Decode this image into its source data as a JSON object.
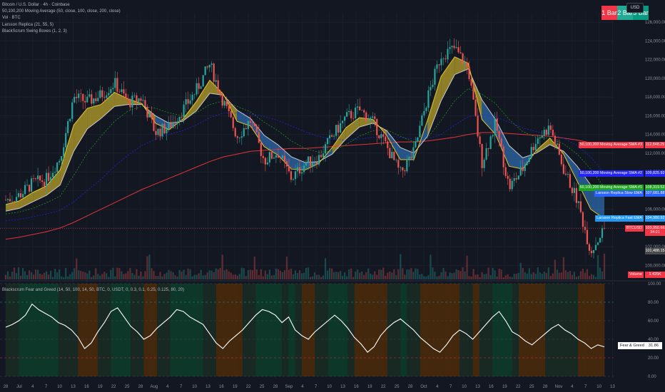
{
  "header": {
    "symbol_line": "Bitcoin / U.S. Dollar · 4h · Coinbase",
    "indicators": [
      "50,100,200 Moving Average (50, close, 100, close, 200, close)",
      "Vol · BTC",
      "Larsson Replica (21, 55, 5)",
      "BlackScrum Swing Boxes (1, 2, 3)"
    ],
    "currency": "USD",
    "bar_buttons": [
      {
        "label": "1 Bar",
        "color": "#f23645"
      },
      {
        "label": "2 Bar",
        "color": "#22ab94"
      },
      {
        "label": "3 Bar",
        "color": "#22ab94"
      }
    ]
  },
  "price_tags": [
    {
      "label": "50,100,200 Moving Average SMA #3",
      "value": "112,848.25",
      "color": "#f23645",
      "price": 112848
    },
    {
      "label": "50,100,200 Moving Average SMA #2",
      "value": "109,825.92",
      "color": "#2424f5",
      "price": 109826
    },
    {
      "label": "50,100,200 Moving Average SMA #1",
      "value": "108,319.52",
      "color": "#1ea31e",
      "price": 108320
    },
    {
      "label": "Larsson Replica Slow EMA",
      "value": "107,681.88",
      "color": "#2962ff",
      "price": 107682
    },
    {
      "label": "Larsson Replica Fast EMA",
      "value": "104,980.92",
      "color": "#2196f3",
      "price": 104981
    },
    {
      "label": "BTCUSD",
      "value": "103,950.66",
      "color": "#f23645",
      "price": 103951
    },
    {
      "label": "",
      "value": "34:21",
      "color": "#f23645",
      "price": 103500
    },
    {
      "label": "",
      "value": "101,488.15",
      "color": "#4a4a4a",
      "price": 101488
    }
  ],
  "volume_tag": {
    "label": "Volume",
    "value": "1.425K",
    "color": "#f23645"
  },
  "oscillator": {
    "title": "Blackscrum Fear and Greed (14, 50, 100, 14, 50, BTC, 0, USDT, 0, 0.3, 0.1, 0.25, 0.125, 80, 20)",
    "label": "Fear & Greed Score",
    "value": "31.86",
    "ticks": [
      "100.00",
      "80.00",
      "60.00",
      "40.00",
      "20.00",
      "0.00"
    ]
  },
  "chart_data": {
    "type": "line",
    "title": "Bitcoin / U.S. Dollar · 4h · Coinbase",
    "y_axis_ticks": [
      "126,000.00",
      "124,000.00",
      "122,000.00",
      "120,000.00",
      "118,000.00",
      "116,000.00",
      "114,000.00",
      "112,000.00",
      "110,000.00",
      "108,000.00",
      "106,000.00",
      "104,000.00",
      "102,000.00",
      "100,000.00"
    ],
    "ylim": [
      98500,
      127000
    ],
    "x_axis_ticks": [
      "28",
      "Jul",
      "4",
      "7",
      "10",
      "13",
      "16",
      "19",
      "22",
      "25",
      "28",
      "Aug",
      "4",
      "7",
      "10",
      "13",
      "16",
      "19",
      "22",
      "25",
      "28",
      "Sep",
      "4",
      "7",
      "10",
      "13",
      "16",
      "19",
      "22",
      "25",
      "28",
      "Oct",
      "4",
      "7",
      "10",
      "13",
      "16",
      "19",
      "22",
      "25",
      "28",
      "Nov",
      "4",
      "7",
      "10",
      "13"
    ],
    "x_dates": [
      "2025-06-27",
      "2025-07-01",
      "2025-07-04",
      "2025-07-07",
      "2025-07-10",
      "2025-07-13",
      "2025-07-16",
      "2025-07-19",
      "2025-07-22",
      "2025-07-25",
      "2025-07-28",
      "2025-08-01",
      "2025-08-04",
      "2025-08-07",
      "2025-08-10",
      "2025-08-13",
      "2025-08-16",
      "2025-08-19",
      "2025-08-22",
      "2025-08-25",
      "2025-08-28",
      "2025-09-01",
      "2025-09-04",
      "2025-09-07",
      "2025-09-10",
      "2025-09-13",
      "2025-09-16",
      "2025-09-19",
      "2025-09-22",
      "2025-09-25",
      "2025-09-28",
      "2025-10-01",
      "2025-10-04",
      "2025-10-07",
      "2025-10-10",
      "2025-10-13",
      "2025-10-16",
      "2025-10-19",
      "2025-10-22",
      "2025-10-25",
      "2025-10-28",
      "2025-11-01",
      "2025-11-04"
    ],
    "series": [
      {
        "name": "BTCUSD",
        "color": "#d1d4dc",
        "values": [
          107000,
          107500,
          108800,
          109200,
          111500,
          118000,
          117500,
          118200,
          119500,
          117400,
          117900,
          114200,
          114800,
          116600,
          118700,
          121500,
          117500,
          113800,
          115500,
          111200,
          112100,
          109300,
          110900,
          111500,
          113800,
          115800,
          116600,
          115300,
          112700,
          109800,
          112100,
          117900,
          122500,
          123200,
          121000,
          111000,
          115200,
          108300,
          110300,
          113500,
          114800,
          110300,
          107000,
          101488,
          103951
        ]
      },
      {
        "name": "Larsson Replica Fast EMA",
        "color": "#e8c62b",
        "values": [
          106500,
          106900,
          107800,
          108500,
          110200,
          115000,
          116800,
          117200,
          118500,
          117800,
          117300,
          115200,
          114500,
          115600,
          117500,
          119800,
          118300,
          115400,
          114900,
          112700,
          111800,
          110300,
          110200,
          110900,
          112600,
          114700,
          115800,
          115600,
          113900,
          111300,
          111300,
          115500,
          120200,
          122300,
          121600,
          115600,
          114000,
          110600,
          110300,
          112300,
          113600,
          111900,
          109000,
          106000,
          104981
        ]
      },
      {
        "name": "Larsson Replica Slow EMA",
        "color": "#c9c9c9",
        "values": [
          105800,
          106100,
          106800,
          107500,
          108600,
          112200,
          114600,
          115700,
          117000,
          117200,
          117200,
          116000,
          115200,
          115400,
          116500,
          118400,
          118200,
          116600,
          115700,
          113900,
          112900,
          111600,
          111000,
          111100,
          111900,
          113500,
          114800,
          115200,
          114400,
          112600,
          112000,
          113800,
          117600,
          120400,
          121000,
          117700,
          115600,
          112800,
          111500,
          112000,
          112900,
          112200,
          110600,
          108600,
          107682
        ]
      },
      {
        "name": "50,100,200 Moving Average SMA #1",
        "color": "#1ea31e",
        "values": [
          105500,
          105700,
          106100,
          106700,
          107400,
          109600,
          112000,
          113800,
          115400,
          116500,
          117000,
          116800,
          116300,
          116000,
          116300,
          117200,
          117600,
          117000,
          116400,
          115300,
          114400,
          113300,
          112500,
          112100,
          112200,
          112900,
          113800,
          114400,
          114500,
          113800,
          113200,
          113600,
          115500,
          117600,
          118900,
          118300,
          117300,
          115600,
          114300,
          113700,
          113600,
          113000,
          111900,
          110300,
          108320
        ]
      },
      {
        "name": "50,100,200 Moving Average SMA #2",
        "color": "#2424f5",
        "values": [
          104800,
          104900,
          105200,
          105500,
          105900,
          106800,
          108000,
          109200,
          110600,
          111800,
          112800,
          113500,
          114000,
          114400,
          115000,
          115800,
          116300,
          116300,
          116200,
          115900,
          115500,
          114900,
          114300,
          113800,
          113500,
          113400,
          113500,
          113700,
          113800,
          113700,
          113500,
          113500,
          114000,
          115000,
          115900,
          116100,
          115900,
          115300,
          114700,
          114300,
          114000,
          113600,
          112800,
          111600,
          109826
        ]
      },
      {
        "name": "50,100,200 Moving Average SMA #3",
        "color": "#e03535",
        "values": [
          102800,
          103000,
          103300,
          103600,
          104000,
          104600,
          105300,
          106000,
          106700,
          107400,
          108100,
          108700,
          109300,
          109900,
          110500,
          111100,
          111600,
          111900,
          112200,
          112300,
          112400,
          112500,
          112500,
          112600,
          112700,
          112800,
          112900,
          113000,
          113100,
          113200,
          113200,
          113300,
          113500,
          113700,
          114000,
          114200,
          114200,
          114100,
          114000,
          113900,
          113800,
          113600,
          113400,
          113100,
          112848
        ]
      }
    ],
    "fear_greed": {
      "name": "Fear & Greed Score",
      "ylim": [
        0,
        100
      ],
      "values": [
        53,
        56,
        60,
        66,
        78,
        72,
        68,
        64,
        58,
        55,
        50,
        42,
        30,
        36,
        48,
        58,
        70,
        74,
        64,
        54,
        48,
        40,
        44,
        52,
        58,
        64,
        72,
        70,
        64,
        60,
        56,
        46,
        36,
        30,
        38,
        44,
        50,
        58,
        66,
        72,
        70,
        66,
        58,
        64,
        50,
        44,
        40,
        48,
        54,
        60,
        66,
        60,
        52,
        42,
        35,
        26,
        32,
        44,
        52,
        58,
        62,
        56,
        50,
        42,
        36,
        30,
        26,
        34,
        44,
        50,
        46,
        40,
        48,
        56,
        64,
        70,
        60,
        48,
        44,
        38,
        34,
        40,
        46,
        52,
        56,
        50,
        46,
        40,
        36,
        30,
        34,
        31.86
      ],
      "threshold_high": 80,
      "threshold_low": 20
    }
  }
}
